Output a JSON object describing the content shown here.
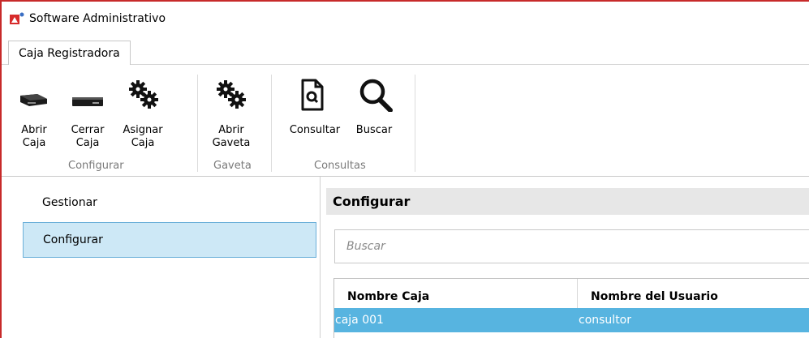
{
  "window": {
    "title": "Software Administrativo"
  },
  "tabs": [
    {
      "label": "Caja Registradora"
    }
  ],
  "ribbon": {
    "buttons": {
      "abrir_caja": "Abrir\nCaja",
      "cerrar_caja": "Cerrar\nCaja",
      "asignar_caja": "Asignar\nCaja",
      "abrir_gaveta": "Abrir\nGaveta",
      "consultar": "Consultar",
      "buscar": "Buscar"
    },
    "groups": {
      "configurar": "Configurar",
      "gaveta": "Gaveta",
      "consultas": "Consultas"
    }
  },
  "nav": {
    "items": [
      {
        "label": "Gestionar",
        "selected": false
      },
      {
        "label": "Configurar",
        "selected": true
      }
    ]
  },
  "content": {
    "header": "Configurar",
    "search": {
      "placeholder": "Buscar",
      "value": ""
    },
    "table": {
      "columns": [
        "Nombre Caja",
        "Nombre del Usuario"
      ],
      "rows": [
        [
          "caja 001",
          "consultor"
        ]
      ],
      "selected_row_color": "#57b4e0"
    }
  },
  "colors": {
    "window_border": "#c72a2a",
    "nav_selected": "#cde8f6",
    "header_bg": "#e7e7e7"
  },
  "icons": {
    "app": "app-logo-icon",
    "abrir_caja": "cash-register-open-icon",
    "cerrar_caja": "cash-register-closed-icon",
    "asignar_caja": "gears-icon",
    "abrir_gaveta": "gears-icon",
    "consultar": "document-search-icon",
    "buscar": "magnifier-icon"
  }
}
